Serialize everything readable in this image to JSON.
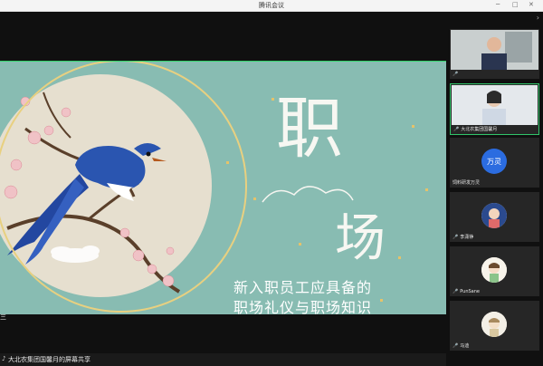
{
  "window": {
    "title": "腾讯会议",
    "minimize_icon": "minimize-icon",
    "maximize_icon": "maximize-icon",
    "close_icon": "close-icon"
  },
  "slide": {
    "big_char_1": "职",
    "big_char_2": "场",
    "subtitle_line1": "新入职员工应具备的",
    "subtitle_line2": "职场礼仪与职场知识",
    "accent_color": "#2fd468",
    "background_color": "#88bcb2"
  },
  "share_bar": {
    "text": "大北农集团国馨月的屏幕共享",
    "mic_icon": "mic-icon"
  },
  "side_menu": {
    "label": "三"
  },
  "participants": [
    {
      "name": "",
      "avatar_text": "",
      "type": "video"
    },
    {
      "name": "大北农集团国馨月",
      "avatar_text": "",
      "type": "video"
    },
    {
      "name": "饲料研发万灵",
      "avatar_text": "万灵",
      "type": "avatar-text"
    },
    {
      "name": "李潇铮",
      "avatar_text": "",
      "type": "avatar-image"
    },
    {
      "name": "PunSane",
      "avatar_text": "",
      "type": "avatar-image"
    },
    {
      "name": "马迪",
      "avatar_text": "",
      "type": "avatar-image"
    }
  ]
}
